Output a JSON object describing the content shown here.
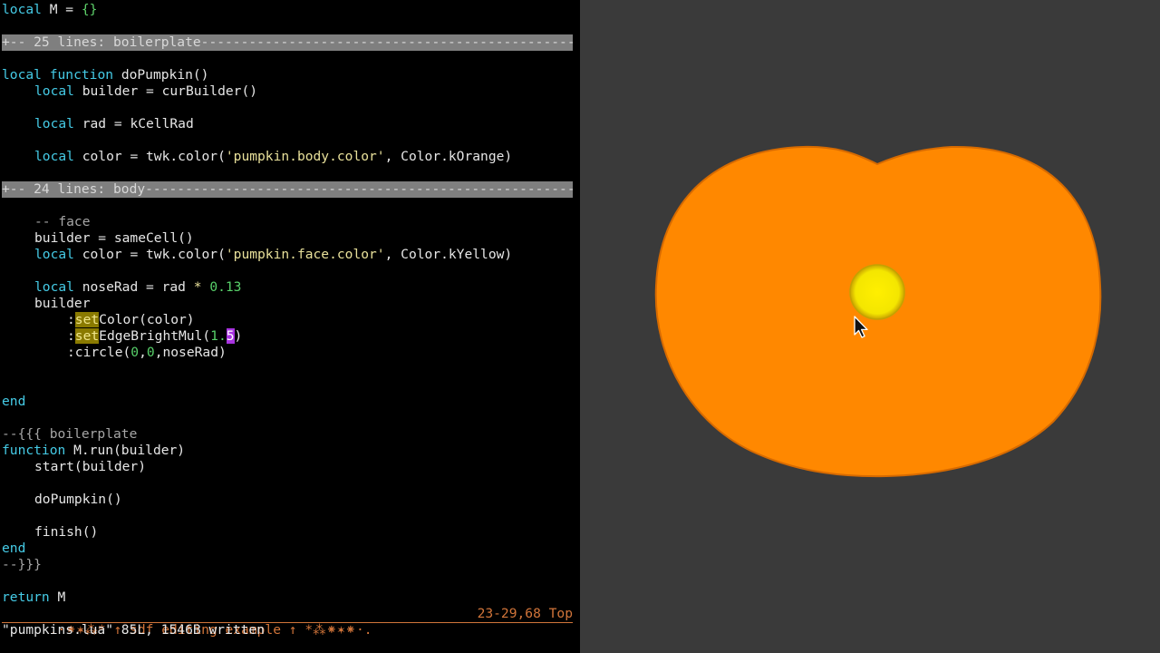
{
  "editor": {
    "lines": {
      "l1": {
        "a": "local",
        "b": " M = ",
        "c": "{}"
      },
      "fold1": "+-- 25 lines: boilerplate---------------------------------------------------",
      "l3": {
        "a": "local",
        "b": " ",
        "c": "function",
        "d": " doPumpkin()"
      },
      "l4": {
        "a": "local",
        "b": " builder = curBuilder()"
      },
      "l5": {
        "a": "local",
        "b": " rad = kCellRad"
      },
      "l6": {
        "a": "local",
        "b": " color = twk.color(",
        "c": "'pumpkin.body.color'",
        "d": ", Color.kOrange)"
      },
      "fold2": "+-- 24 lines: body----------------------------------------------------------",
      "l8": "-- face",
      "l9": "builder = sameCell()",
      "l10": {
        "a": "local",
        "b": " color = twk.color(",
        "c": "'pumpkin.face.color'",
        "d": ", Color.kYellow)"
      },
      "l11": {
        "a": "local",
        "b": " noseRad = rad ",
        "c": "*",
        "d": " ",
        "e": "0.13"
      },
      "l12": "builder",
      "l13": {
        "a": ":",
        "b": "set",
        "c": "Color(color)"
      },
      "l14": {
        "a": ":",
        "b": "set",
        "c": "EdgeBrightMul(",
        "d": "1.",
        "e": "5",
        "f": ")"
      },
      "l15": {
        "a": ":circle(",
        "b": "0",
        "c": ",",
        "d": "0",
        "e": ",noseRad)"
      },
      "l16": "end",
      "l17": "--{{{ boilerplate",
      "l18": {
        "a": "function",
        "b": " M.run(builder)"
      },
      "l19": "start(builder)",
      "l20": "doPumpkin()",
      "l21": "finish()",
      "l22": "end",
      "l23": "--}}}",
      "l24": {
        "a": "return",
        "b": " M"
      }
    },
    "statusline": {
      "left": ".·⁕✶⁂* ↑ sdf editing example ↑ *⁂⁕✶⁕·.",
      "position": "23-29,68 Top"
    },
    "cmdline": "\"pumpkins.lua\" 85L, 1546B written"
  },
  "viewport": {
    "background": "#3a3a3a",
    "pumpkin_color": "#ff8800",
    "nose_color": "#f4e900"
  }
}
